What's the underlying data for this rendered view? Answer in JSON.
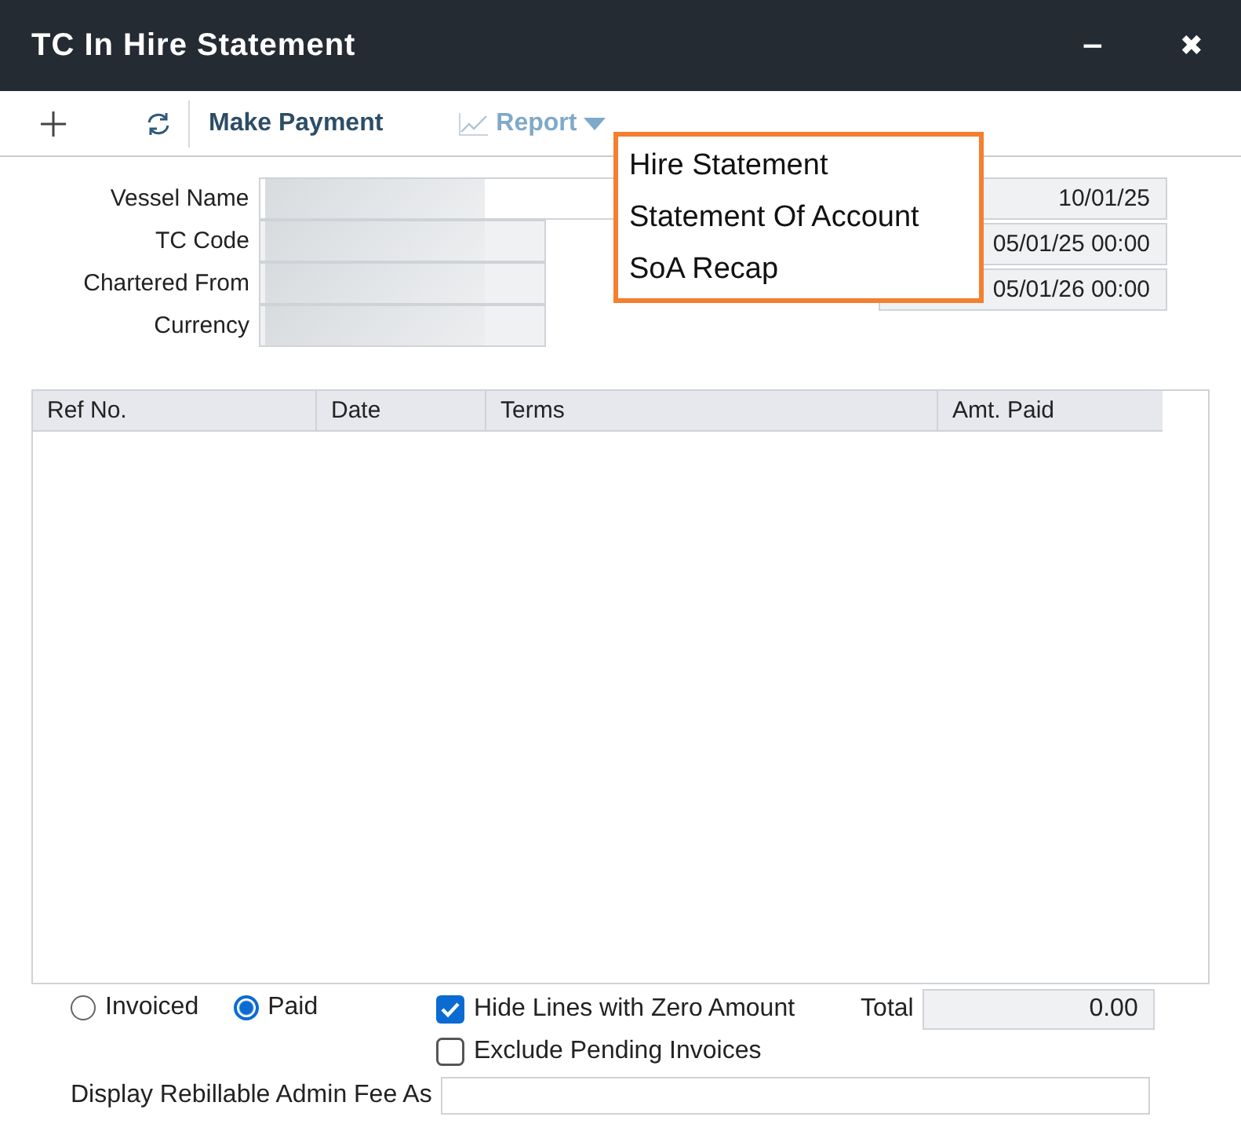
{
  "window": {
    "title": "TC In Hire Statement",
    "minimize": "−",
    "close": "✖"
  },
  "toolbar": {
    "make_payment": "Make Payment",
    "report": "Report",
    "report_menu_open": true
  },
  "report_menu": [
    {
      "label": "Hire Statement"
    },
    {
      "label": "Statement Of Account"
    },
    {
      "label": "SoA Recap"
    }
  ],
  "left_fields": [
    {
      "label": "Vessel Name",
      "wide": true
    },
    {
      "label": "TC Code",
      "wide": false
    },
    {
      "label": "Chartered From",
      "wide": false
    },
    {
      "label": "Currency",
      "wide": false
    }
  ],
  "right_fields": [
    {
      "value": "10/01/25"
    },
    {
      "value": "05/01/25 00:00"
    },
    {
      "value": "05/01/26 00:00"
    }
  ],
  "table": {
    "columns": [
      "Ref No.",
      "Date",
      "Terms",
      "Amt. Paid"
    ]
  },
  "filter": [
    {
      "label": "Invoiced",
      "selected": false
    },
    {
      "label": "Paid",
      "selected": true
    }
  ],
  "options": [
    {
      "label": "Hide Lines with Zero Amount",
      "checked": true
    },
    {
      "label": "Exclude Pending Invoices",
      "checked": false
    }
  ],
  "total": {
    "label": "Total",
    "value": "0.00"
  },
  "admin_fee": {
    "label": "Display Rebillable Admin Fee As"
  }
}
